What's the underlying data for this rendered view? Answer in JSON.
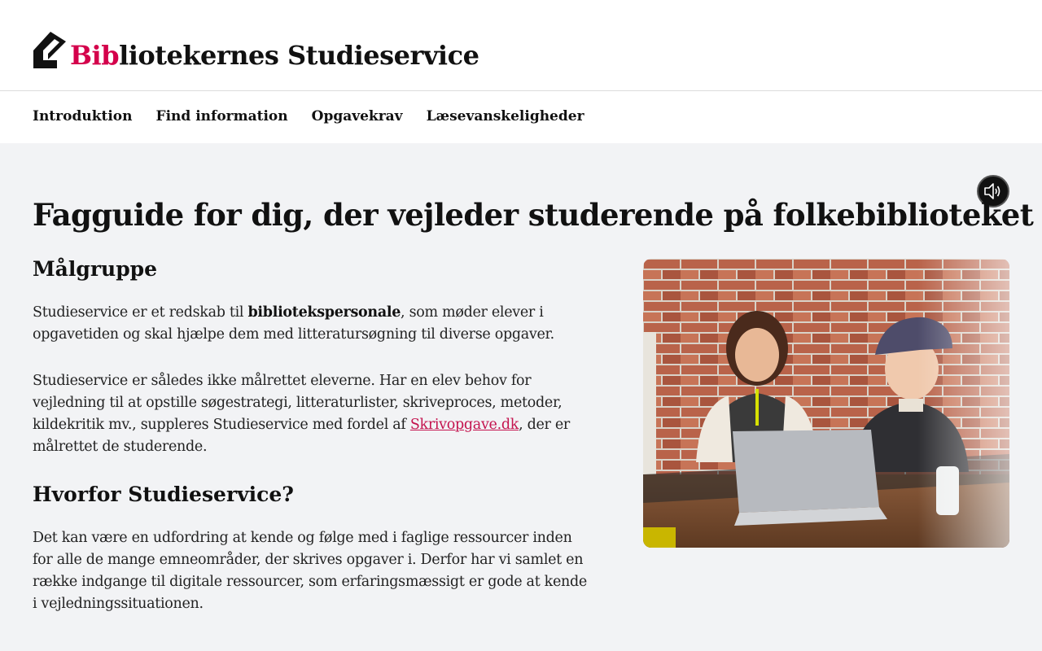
{
  "header": {
    "logo_accent": "Bib",
    "logo_rest": "liotekernes Studieservice"
  },
  "nav": {
    "items": [
      "Introduktion",
      "Find information",
      "Opgavekrav",
      "Læsevanskeligheder"
    ]
  },
  "main": {
    "title": "Fagguide for dig, der vejleder studerende på folkebiblioteket",
    "section1": {
      "heading": "Målgruppe",
      "p1_before": "Studieservice er et redskab til ",
      "p1_strong": "bibliotekspersonale",
      "p1_after": ", som møder elever i opgavetiden og skal hjælpe dem med litteratursøgning til diverse opgaver.",
      "p2_before": "Studieservice er således ikke målrettet eleverne. Har en elev behov for vejledning til at opstille søgestrategi, litteraturlister, skriveproces, metoder, kildekritik mv., suppleres Studieservice med fordel af ",
      "p2_link": "Skrivopgave.dk",
      "p2_after": ", der er målrettet de studerende."
    },
    "section2": {
      "heading": "Hvorfor Studieservice?",
      "p1": "Det kan være en udfordring at kende og følge med i faglige ressourcer inden for alle de mange emneområder, der skrives opgaver i. Derfor har vi samlet en række indgange til digitale ressourcer, som erfaringsmæssigt er gode at kende i vejledningssituationen."
    }
  },
  "colors": {
    "accent": "#d4004b",
    "link": "#c4134e",
    "background": "#f2f3f5"
  },
  "icons": {
    "logo": "arrow-logo-icon",
    "audio": "speaker-icon"
  }
}
